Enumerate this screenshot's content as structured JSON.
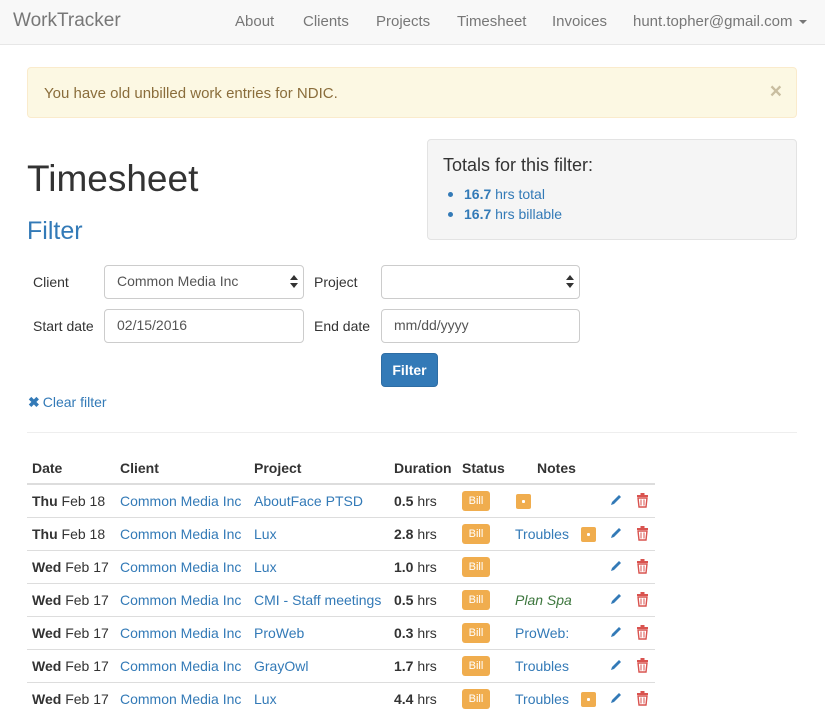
{
  "navbar": {
    "brand": "WorkTracker",
    "links": [
      "About",
      "Clients",
      "Projects",
      "Timesheet",
      "Invoices"
    ],
    "user": "hunt.topher@gmail.com"
  },
  "alert": {
    "message": "You have old unbilled work entries for NDIC.",
    "close": "×"
  },
  "page": {
    "title": "Timesheet",
    "filter_heading": "Filter"
  },
  "totals": {
    "heading": "Totals for this filter:",
    "total_value": "16.7",
    "total_suffix": " hrs total",
    "billable_value": "16.7",
    "billable_suffix": " hrs billable"
  },
  "filter_form": {
    "client_label": "Client",
    "client_value": "Common Media Inc",
    "project_label": "Project",
    "project_value": "",
    "start_label": "Start date",
    "start_value": "02/15/2016",
    "end_label": "End date",
    "end_placeholder": "mm/dd/yyyy",
    "submit_label": "Filter",
    "clear_label": "Clear filter",
    "clear_icon": "✖"
  },
  "table": {
    "headers": [
      "Date",
      "Client",
      "Project",
      "Duration",
      "Status",
      "Notes"
    ],
    "hrs_label": " hrs",
    "rows": [
      {
        "day": "Thu",
        "date": " Feb 18",
        "client": "Common Media Inc",
        "project": "AboutFace PTSD",
        "hours": "0.5",
        "status": "Bill",
        "note": "",
        "note_style": "none",
        "note_icon": true
      },
      {
        "day": "Thu",
        "date": " Feb 18",
        "client": "Common Media Inc",
        "project": "Lux",
        "hours": "2.8",
        "status": "Bill",
        "note": "Troubles",
        "note_style": "link",
        "note_icon": true
      },
      {
        "day": "Wed",
        "date": " Feb 17",
        "client": "Common Media Inc",
        "project": "Lux",
        "hours": "1.0",
        "status": "Bill",
        "note": "",
        "note_style": "none",
        "note_icon": false
      },
      {
        "day": "Wed",
        "date": " Feb 17",
        "client": "Common Media Inc",
        "project": "CMI - Staff meetings",
        "hours": "0.5",
        "status": "Bill",
        "note": "Plan Spa",
        "note_style": "italic",
        "note_icon": false
      },
      {
        "day": "Wed",
        "date": " Feb 17",
        "client": "Common Media Inc",
        "project": "ProWeb",
        "hours": "0.3",
        "status": "Bill",
        "note": "ProWeb:",
        "note_style": "link",
        "note_icon": false
      },
      {
        "day": "Wed",
        "date": " Feb 17",
        "client": "Common Media Inc",
        "project": "GrayOwl",
        "hours": "1.7",
        "status": "Bill",
        "note": "Troubles",
        "note_style": "link",
        "note_icon": false
      },
      {
        "day": "Wed",
        "date": " Feb 17",
        "client": "Common Media Inc",
        "project": "Lux",
        "hours": "4.4",
        "status": "Bill",
        "note": "Troubles",
        "note_style": "link",
        "note_icon": true
      }
    ]
  },
  "colors": {
    "link": "#337ab7",
    "warning_badge": "#f0ad4e",
    "edit_icon": "#337ab7",
    "delete_icon": "#d9534f",
    "alert_bg": "#fcf8e3",
    "alert_text": "#8a6d3b"
  },
  "icons": {
    "edit": "pencil-icon",
    "delete": "trash-icon",
    "note": "note-icon"
  }
}
